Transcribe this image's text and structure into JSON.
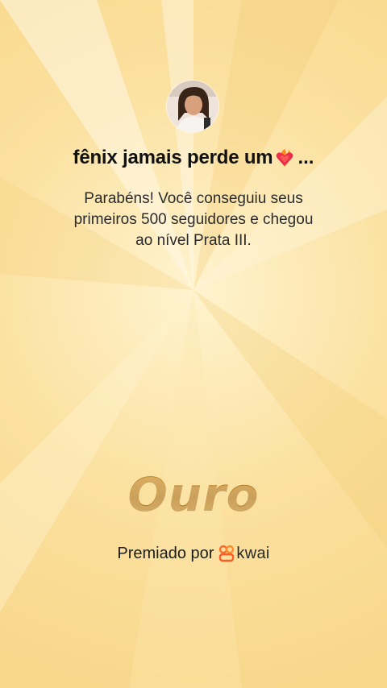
{
  "profile": {
    "avatar_icon": "profile-photo-avatar",
    "username": "fênix jamais perde um",
    "username_emoji": "heart-on-fire-icon",
    "username_ellipsis": "..."
  },
  "message": {
    "line1": "Parabéns! Você conseguiu seus",
    "line2": "primeiros 500 seguidores e chegou",
    "line3": "ao nível Prata III."
  },
  "level": {
    "title": "Ouro",
    "color": "#b07a1e"
  },
  "award": {
    "label": "Premiado por",
    "brand_icon": "kwai-logo-icon",
    "brand_name": "kwai",
    "brand_color": "#ff6a2b"
  },
  "theme": {
    "background": "#fbe3a3",
    "ray_light": "#fff6dc",
    "ray_dark": "#f5d27a"
  }
}
